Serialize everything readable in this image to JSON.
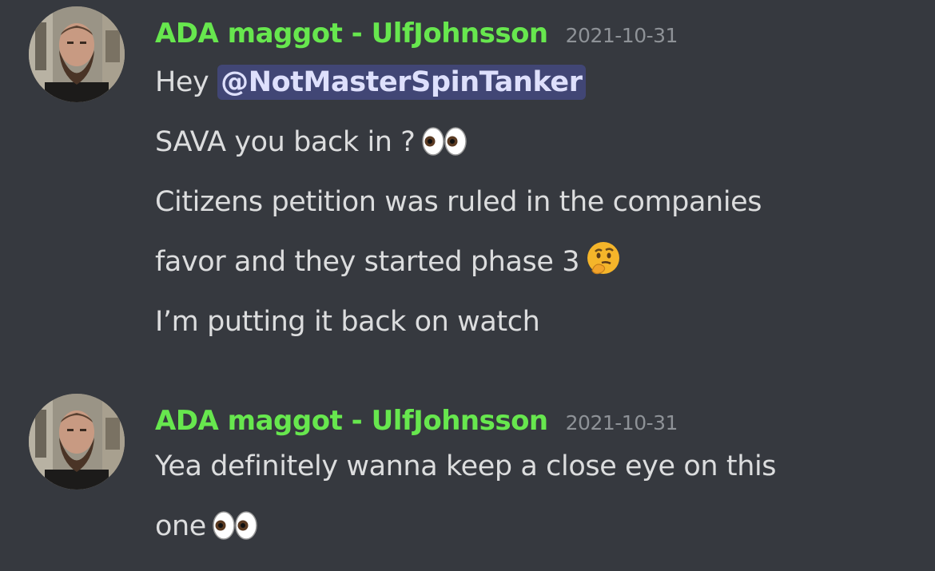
{
  "messages": [
    {
      "username": "ADA maggot - UlfJohnsson",
      "timestamp": "2021-10-31",
      "lines": [
        {
          "prefix": "Hey ",
          "mention": "@NotMasterSpinTanker"
        },
        {
          "text": "SAVA you back in ?",
          "emoji": "eyes"
        },
        {
          "text": "Citizens petition was ruled in the companies"
        },
        {
          "text": "favor and they started phase 3",
          "emoji": "thinking"
        },
        {
          "text": "I’m putting it back on watch"
        }
      ]
    },
    {
      "username": "ADA maggot - UlfJohnsson",
      "timestamp": "2021-10-31",
      "lines": [
        {
          "text": "Yea definitely wanna keep a close eye on this"
        },
        {
          "text": "one",
          "emoji": "eyes"
        }
      ]
    }
  ],
  "colors": {
    "background": "#36393f",
    "username": "#67e74e",
    "timestamp": "#8e9297",
    "text": "#dcddde",
    "mention_bg": "#414675",
    "mention_text": "#dee0fc"
  }
}
